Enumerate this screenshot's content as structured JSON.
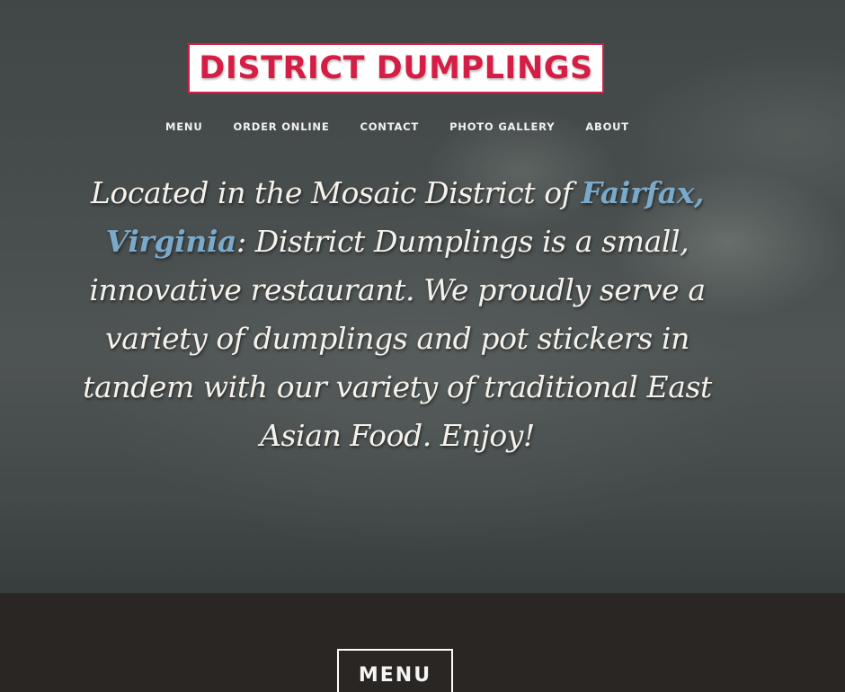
{
  "brand": {
    "logo_text": "DISTRICT DUMPLINGS",
    "logo_color": "#d51e45"
  },
  "nav": {
    "items": [
      {
        "label": "MENU"
      },
      {
        "label": "ORDER ONLINE"
      },
      {
        "label": "CONTACT"
      },
      {
        "label": "PHOTO GALLERY"
      },
      {
        "label": "ABOUT"
      }
    ]
  },
  "intro": {
    "prefix": "Located in the Mosaic District of ",
    "location_link": "Fairfax, Virginia",
    "suffix": ": District Dumplings is a small, innovative restaurant. We proudly serve a variety of dumplings and pot stickers in tandem with our variety of traditional East Asian Food. Enjoy!",
    "link_color": "#7ba9c9"
  },
  "section": {
    "menu_button_label": "MENU",
    "background_color": "#2a2623"
  }
}
